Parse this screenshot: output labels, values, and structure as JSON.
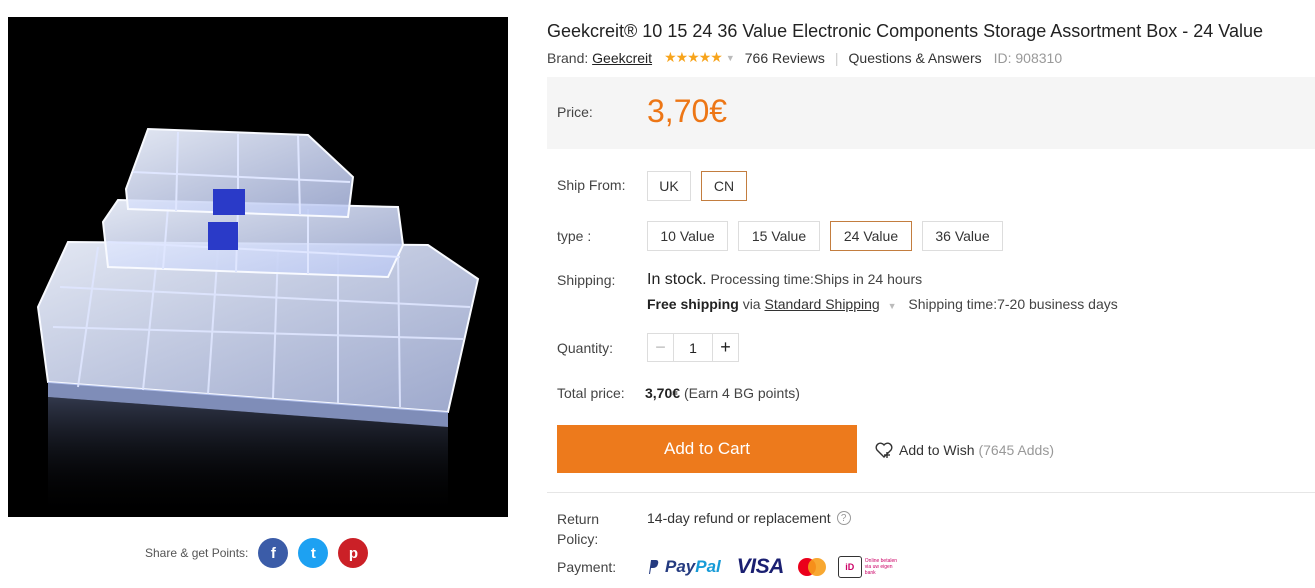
{
  "product": {
    "title": "Geekcreit® 10 15 24 36 Value Electronic Components Storage Assortment Box - 24 Value",
    "brand_label": "Brand:",
    "brand": "Geekcreit",
    "stars": "★★★★★",
    "reviews": "766 Reviews",
    "qa": "Questions & Answers",
    "id": "ID: 908310",
    "rating": 5
  },
  "price": {
    "label": "Price:",
    "value": "3,70€"
  },
  "ship_from": {
    "label": "Ship From:",
    "options": [
      "UK",
      "CN"
    ],
    "selected": "CN"
  },
  "type": {
    "label": "type :",
    "options": [
      "10 Value",
      "15 Value",
      "24 Value",
      "36 Value"
    ],
    "selected": "24 Value"
  },
  "shipping": {
    "label": "Shipping:",
    "stock": "In stock.",
    "processing": "Processing time:Ships in 24 hours",
    "free": "Free shipping",
    "via": "via",
    "method": "Standard Shipping",
    "time": "Shipping time:7-20 business days"
  },
  "quantity": {
    "label": "Quantity:",
    "value": "1",
    "minus": "−",
    "plus": "+"
  },
  "total": {
    "label": "Total price:",
    "value": "3,70€",
    "points": "(Earn 4 BG points)"
  },
  "cart": {
    "label": "Add to Cart"
  },
  "wish": {
    "label": "Add to Wish",
    "adds": "(7645 Adds)"
  },
  "return_policy": {
    "label": "Return Policy:",
    "value": "14-day refund or replacement",
    "help": "?"
  },
  "payment": {
    "label": "Payment:",
    "paypal": "Pay",
    "paypal2": "Pal",
    "visa": "VISA",
    "ideal": "iD",
    "ideal_text": "Online betalen via uw eigen bank"
  },
  "share": {
    "label": "Share & get Points:",
    "facebook": "f",
    "twitter": "t",
    "pinterest": "p"
  },
  "colors": {
    "accent": "#ed7a1c",
    "price": "#ed7615",
    "selected_border": "#c37d3f"
  }
}
